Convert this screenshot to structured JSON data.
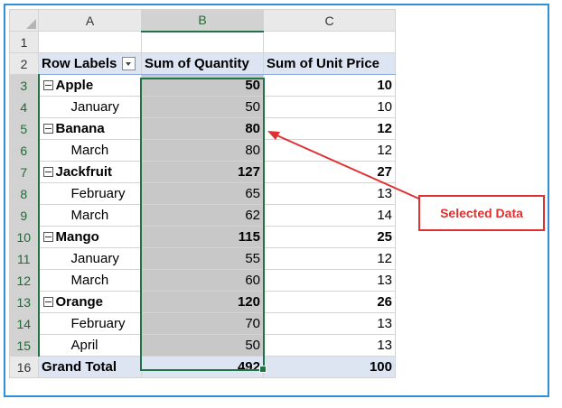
{
  "columns": [
    "A",
    "B",
    "C"
  ],
  "header_row": {
    "row_number": "2",
    "row_labels": "Row Labels",
    "sum_quantity": "Sum of Quantity",
    "sum_unit_price": "Sum of Unit Price"
  },
  "rows": [
    {
      "n": "3",
      "label": "Apple",
      "qty": "50",
      "price": "10",
      "group": true
    },
    {
      "n": "4",
      "label": "January",
      "qty": "50",
      "price": "10",
      "group": false
    },
    {
      "n": "5",
      "label": "Banana",
      "qty": "80",
      "price": "12",
      "group": true
    },
    {
      "n": "6",
      "label": "March",
      "qty": "80",
      "price": "12",
      "group": false
    },
    {
      "n": "7",
      "label": "Jackfruit",
      "qty": "127",
      "price": "27",
      "group": true
    },
    {
      "n": "8",
      "label": "February",
      "qty": "65",
      "price": "13",
      "group": false
    },
    {
      "n": "9",
      "label": "March",
      "qty": "62",
      "price": "14",
      "group": false
    },
    {
      "n": "10",
      "label": "Mango",
      "qty": "115",
      "price": "25",
      "group": true
    },
    {
      "n": "11",
      "label": "January",
      "qty": "55",
      "price": "12",
      "group": false
    },
    {
      "n": "12",
      "label": "March",
      "qty": "60",
      "price": "13",
      "group": false
    },
    {
      "n": "13",
      "label": "Orange",
      "qty": "120",
      "price": "26",
      "group": true
    },
    {
      "n": "14",
      "label": "February",
      "qty": "70",
      "price": "13",
      "group": false
    },
    {
      "n": "15",
      "label": "April",
      "qty": "50",
      "price": "13",
      "group": false
    }
  ],
  "grand_total": {
    "n": "16",
    "label": "Grand Total",
    "qty": "492",
    "price": "100"
  },
  "row1_number": "1",
  "callout": {
    "text": "Selected Data",
    "color": "#e03030"
  },
  "colors": {
    "selection": "#217346",
    "pivot_header": "#dde4f2",
    "frame": "#2f8fd8"
  }
}
